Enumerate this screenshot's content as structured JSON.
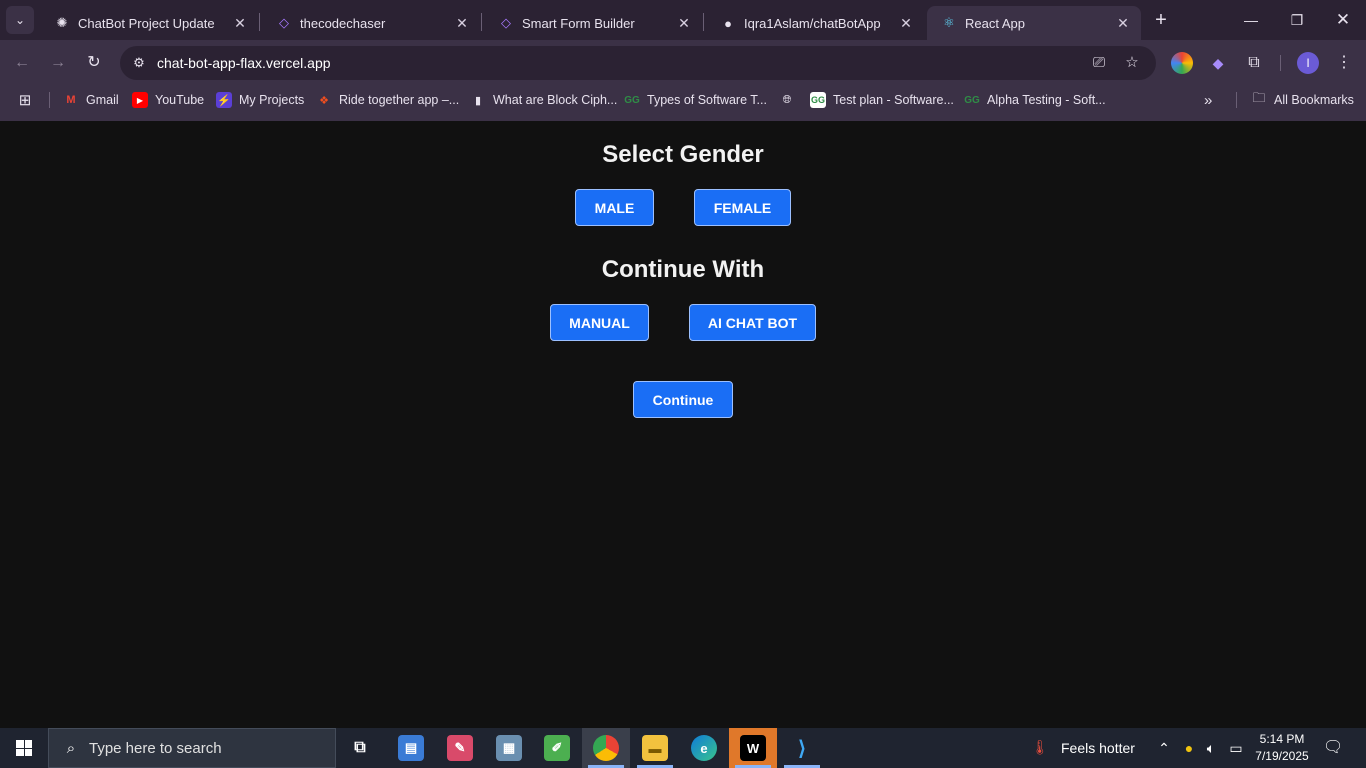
{
  "browser": {
    "tabs": [
      {
        "title": "ChatBot Project Update",
        "icon": "openai-icon"
      },
      {
        "title": "thecodechaser",
        "icon": "code-icon"
      },
      {
        "title": "Smart Form Builder",
        "icon": "code-icon"
      },
      {
        "title": "Iqra1Aslam/chatBotApp",
        "icon": "github-icon"
      },
      {
        "title": "React App",
        "icon": "react-icon",
        "active": true
      }
    ],
    "url": "chat-bot-app-flax.vercel.app",
    "bookmarks": [
      {
        "label": "Gmail"
      },
      {
        "label": "YouTube"
      },
      {
        "label": "My Projects"
      },
      {
        "label": "Ride together app –..."
      },
      {
        "label": "What are Block Ciph..."
      },
      {
        "label": "Types of Software T..."
      },
      {
        "label": ""
      },
      {
        "label": "Test plan - Software..."
      },
      {
        "label": "Alpha Testing - Soft..."
      }
    ],
    "all_bookmarks": "All Bookmarks",
    "profile_initial": "I"
  },
  "page": {
    "gender_heading": "Select Gender",
    "male": "MALE",
    "female": "FEMALE",
    "continue_with_heading": "Continue With",
    "manual": "MANUAL",
    "ai_chat_bot": "AI CHAT BOT",
    "continue": "Continue"
  },
  "taskbar": {
    "search_placeholder": "Type here to search",
    "weather": "Feels hotter",
    "time": "5:14 PM",
    "date": "7/19/2025"
  },
  "colors": {
    "button_blue": "#1a6ef5",
    "page_bg": "#111111",
    "chrome_bg": "#3b3146"
  }
}
